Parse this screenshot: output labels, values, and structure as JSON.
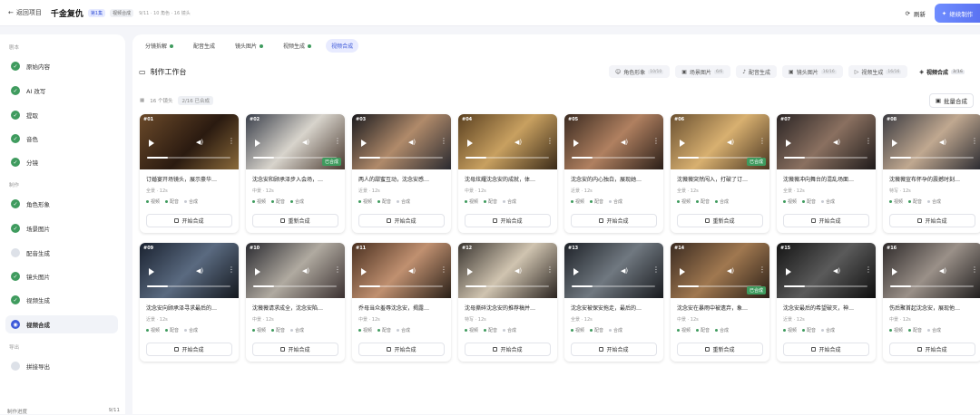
{
  "topbar": {
    "back": "返回项目",
    "title": "千金复仇",
    "episode": "第1集",
    "badge": "视频合成",
    "meta": "9/11 · 10 角色 · 16 镜头",
    "refresh": "刷新",
    "continue": "继续制作"
  },
  "sidebar": {
    "section1": "剧本",
    "items1": [
      "原始内容",
      "AI 改写",
      "提取",
      "音色",
      "分镜"
    ],
    "section2": "制作",
    "items2": [
      "角色形象",
      "场景图片",
      "配音生成",
      "镜头图片",
      "视频生成",
      "视频合成"
    ],
    "section3": "导出",
    "items3": [
      "拼接导出"
    ],
    "progress_label": "制作进度",
    "progress_value": "9/11"
  },
  "tabs": [
    "分镜拆解",
    "配音生成",
    "镜头图片",
    "视频生成",
    "视频合成"
  ],
  "workspace": {
    "title": "制作工作台",
    "sub_count": "16 个镜头",
    "sub_pill": "2/16 已合成",
    "batch": "批量合成"
  },
  "steps": [
    {
      "label": "角色形象",
      "count": "10/10"
    },
    {
      "label": "场景图片",
      "count": "6/6"
    },
    {
      "label": "配音生成",
      "count": ""
    },
    {
      "label": "镜头图片",
      "count": "16/16"
    },
    {
      "label": "视频生成",
      "count": "16/16"
    },
    {
      "label": "视频合成",
      "count": "3/16"
    }
  ],
  "status_labels": [
    "视频",
    "配音",
    "合成"
  ],
  "cards": [
    {
      "num": "#01",
      "desc": "订婚宴开场镜头，展示豪华…",
      "shot": "全景 · 12s",
      "done": false,
      "btn": "开始合成",
      "bg": "linear-gradient(135deg,#6b4a2a,#2a1a10 55%,#8a6a3a)"
    },
    {
      "num": "#02",
      "desc": "沈念安和顾承泽步入会场，…",
      "shot": "中景 · 12s",
      "done": true,
      "done_label": "已合成",
      "btn": "重新合成",
      "bg": "linear-gradient(135deg,#3a3f4a,#d8d4cc 50%,#4a3a30)"
    },
    {
      "num": "#03",
      "desc": "两人的甜蜜互动，沈念安感…",
      "shot": "近景 · 12s",
      "done": false,
      "btn": "开始合成",
      "bg": "linear-gradient(135deg,#1a1a1e,#b08a6a 50%,#2a2a30)"
    },
    {
      "num": "#04",
      "desc": "沈母炫耀沈念安的成就，体…",
      "shot": "中景 · 12s",
      "done": false,
      "btn": "开始合成",
      "bg": "linear-gradient(135deg,#5a4020,#c8a060 50%,#3a2a18)"
    },
    {
      "num": "#05",
      "desc": "沈念安的内心独白，展现她…",
      "shot": "近景 · 12s",
      "done": false,
      "btn": "开始合成",
      "bg": "linear-gradient(135deg,#3a2a20,#b08060 50%,#2a1e18)"
    },
    {
      "num": "#06",
      "desc": "沈薇薇突然闯入，打破了订…",
      "shot": "全景 · 12s",
      "done": true,
      "done_label": "已合成",
      "btn": "重新合成",
      "bg": "linear-gradient(135deg,#6a5030,#d8b070 50%,#4a3520)"
    },
    {
      "num": "#07",
      "desc": "沈薇薇冲向舞台的混乱场面…",
      "shot": "全景 · 12s",
      "done": false,
      "btn": "开始合成",
      "bg": "linear-gradient(135deg,#2a2424,#8a7060 50%,#1e1a1a)"
    },
    {
      "num": "#08",
      "desc": "沈薇薇宣布怀孕的震撼时刻…",
      "shot": "特写 · 12s",
      "done": false,
      "btn": "开始合成",
      "bg": "linear-gradient(135deg,#3a3a40,#c0a890 50%,#2a2a30)"
    },
    {
      "num": "#09",
      "desc": "沈念安向顾承泽寻求最后的…",
      "shot": "近景 · 12s",
      "done": false,
      "btn": "开始合成",
      "bg": "linear-gradient(135deg,#1a2230,#5a6a80 50%,#14181e)"
    },
    {
      "num": "#10",
      "desc": "沈薇薇请求成全，沈念安陷…",
      "shot": "中景 · 12s",
      "done": false,
      "btn": "开始合成",
      "bg": "linear-gradient(135deg,#2a2a30,#b0aaa0 50%,#3a3030)"
    },
    {
      "num": "#11",
      "desc": "乔母当众羞辱沈念安，揭露…",
      "shot": "中景 · 12s",
      "done": false,
      "btn": "开始合成",
      "bg": "linear-gradient(135deg,#4a3020,#c09070 50%,#2a2018)"
    },
    {
      "num": "#12",
      "desc": "沈母撕碎沈念安的推荐稿并…",
      "shot": "特写 · 12s",
      "done": false,
      "btn": "开始合成",
      "bg": "linear-gradient(135deg,#3a3530,#d0c4b0 50%,#2a2420)"
    },
    {
      "num": "#13",
      "desc": "沈念安被保安拖走，最后的…",
      "shot": "全景 · 12s",
      "done": false,
      "btn": "开始合成",
      "bg": "linear-gradient(135deg,#1e2228,#707880 50%,#181a1e)"
    },
    {
      "num": "#14",
      "desc": "沈念安在暴雨中被遗弃，象…",
      "shot": "中景 · 12s",
      "done": true,
      "done_label": "已合成",
      "btn": "重新合成",
      "bg": "linear-gradient(135deg,#3a2a20,#a07850 50%,#2a1e16)"
    },
    {
      "num": "#15",
      "desc": "沈念安最后的希望破灭，神…",
      "shot": "近景 · 12s",
      "done": false,
      "btn": "开始合成",
      "bg": "linear-gradient(135deg,#141414,#5a5a5a 50%,#0e0e0e)"
    },
    {
      "num": "#16",
      "desc": "伤后聚首起沈念安，展现他…",
      "shot": "中景 · 12s",
      "done": false,
      "btn": "开始合成",
      "bg": "linear-gradient(135deg,#2e2a2a,#9a9088 50%,#1e1c1c)"
    }
  ]
}
